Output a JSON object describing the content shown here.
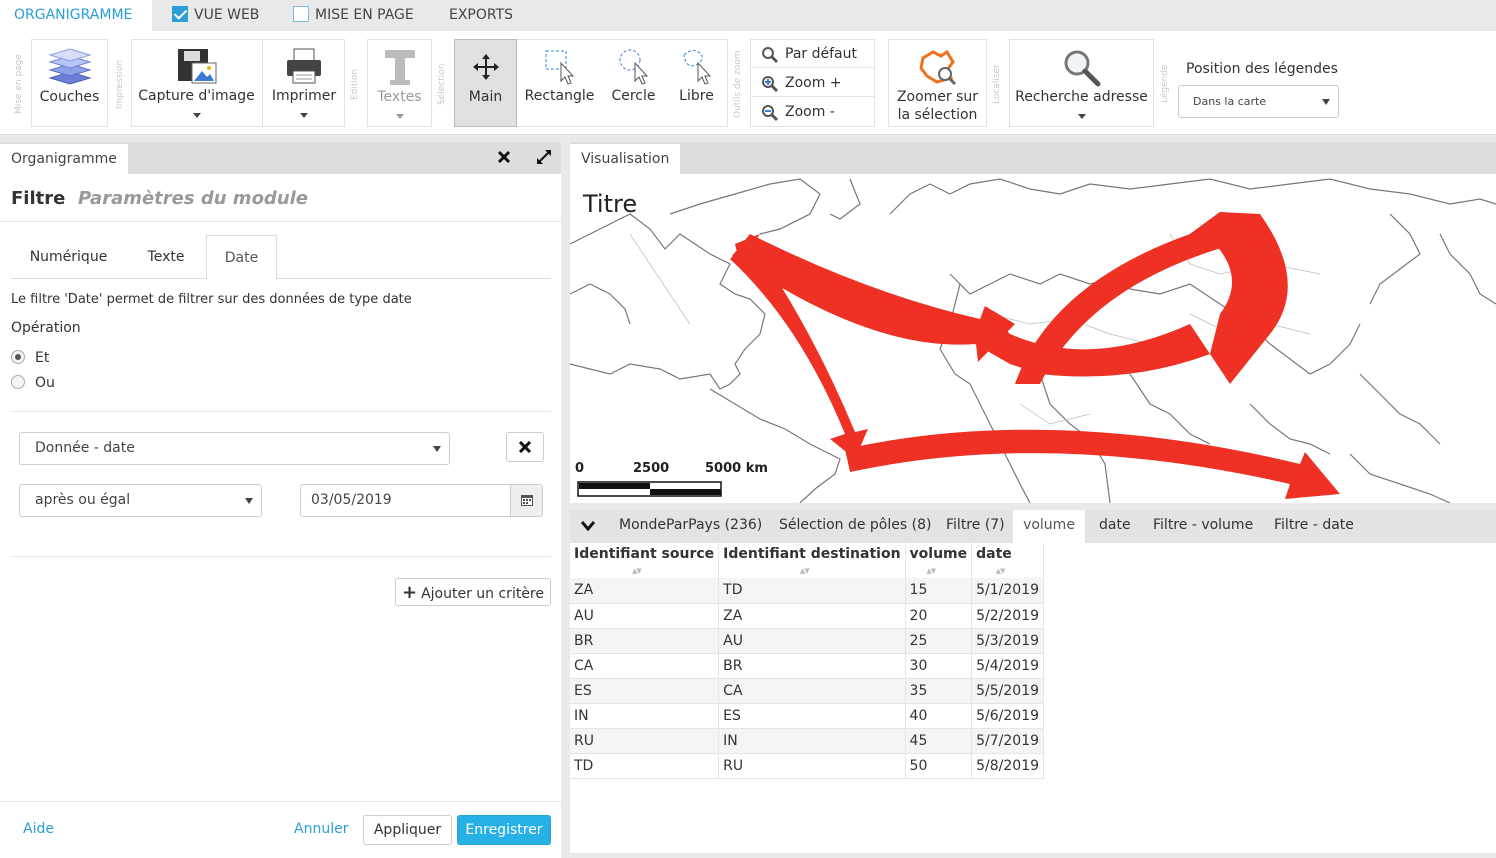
{
  "top_tabs": [
    {
      "label": "ORGANIGRAMME",
      "active": true
    },
    {
      "label": "VUE WEB",
      "checked": true
    },
    {
      "label": "MISE EN PAGE",
      "checked": false
    },
    {
      "label": "EXPORTS"
    }
  ],
  "ribbon": {
    "group_labels": {
      "mise_en_page": "Mise en page",
      "impression": "Impression",
      "edition": "Edition",
      "selection": "Sélection",
      "outils_zoom": "Outils de zoom",
      "localiser": "Localiser",
      "legende": "Légende"
    },
    "couches": "Couches",
    "capture": "Capture d'image",
    "imprimer": "Imprimer",
    "textes": "Textes",
    "main": "Main",
    "rectangle": "Rectangle",
    "cercle": "Cercle",
    "libre": "Libre",
    "par_defaut": "Par défaut",
    "zoom_plus": "Zoom +",
    "zoom_minus": "Zoom -",
    "zoomer_l1": "Zoomer sur",
    "zoomer_l2": "la sélection",
    "recherche": "Recherche adresse",
    "position_legendes_label": "Position des légendes",
    "position_legendes_value": "Dans la carte"
  },
  "left": {
    "tab_label": "Organigramme",
    "header_title": "Filtre",
    "header_subtitle": "Paramètres du module",
    "subtabs": [
      "Numérique",
      "Texte",
      "Date"
    ],
    "active_subtab": "Date",
    "description": "Le filtre 'Date' permet de filtrer sur des données de type date",
    "operation_label": "Opération",
    "radio_et": "Et",
    "radio_ou": "Ou",
    "field_select": "Donnée - date",
    "operator_select": "après ou égal",
    "date_value": "03/05/2019",
    "add_criterion": "Ajouter un critère",
    "footer": {
      "aide": "Aide",
      "annuler": "Annuler",
      "appliquer": "Appliquer",
      "enregistrer": "Enregistrer"
    }
  },
  "right": {
    "tab_label": "Visualisation",
    "map": {
      "title": "Titre",
      "scale_labels": [
        "0",
        "2500",
        "5000 km"
      ],
      "flow_color": "#ee3124"
    },
    "table_tabs": [
      "MondeParPays (236)",
      "Sélection de pôles (8)",
      "Filtre (7)",
      "volume",
      "date",
      "Filtre - volume",
      "Filtre - date"
    ],
    "active_table_tab": "volume",
    "table": {
      "columns": [
        "Identifiant source",
        "Identifiant destination",
        "volume",
        "date"
      ],
      "rows": [
        [
          "ZA",
          "TD",
          "15",
          "5/1/2019"
        ],
        [
          "AU",
          "ZA",
          "20",
          "5/2/2019"
        ],
        [
          "BR",
          "AU",
          "25",
          "5/3/2019"
        ],
        [
          "CA",
          "BR",
          "30",
          "5/4/2019"
        ],
        [
          "ES",
          "CA",
          "35",
          "5/5/2019"
        ],
        [
          "IN",
          "ES",
          "40",
          "5/6/2019"
        ],
        [
          "RU",
          "IN",
          "45",
          "5/7/2019"
        ],
        [
          "TD",
          "RU",
          "50",
          "5/8/2019"
        ]
      ]
    }
  },
  "colors": {
    "accent": "#2a9fd6",
    "primary_button": "#27b0e6"
  }
}
